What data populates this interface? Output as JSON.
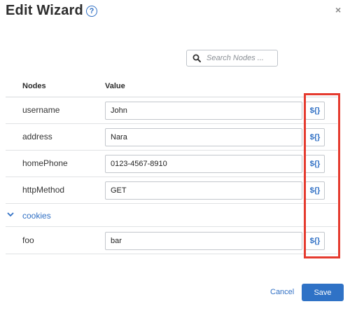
{
  "dialog": {
    "title": "Edit Wizard",
    "help_glyph": "?",
    "close_glyph": "×"
  },
  "search": {
    "placeholder": "Search Nodes ...",
    "value": ""
  },
  "table": {
    "headers": {
      "nodes": "Nodes",
      "value": "Value"
    },
    "rows": [
      {
        "node": "username",
        "value": "John",
        "action": "${}"
      },
      {
        "node": "address",
        "value": "Nara",
        "action": "${}"
      },
      {
        "node": "homePhone",
        "value": "0123-4567-8910",
        "action": "${}"
      },
      {
        "node": "httpMethod",
        "value": "GET",
        "action": "${}"
      }
    ],
    "group": {
      "label": "cookies",
      "expanded": true
    },
    "group_rows": [
      {
        "node": "foo",
        "value": "bar",
        "action": "${}"
      }
    ]
  },
  "footer": {
    "cancel_label": "Cancel",
    "save_label": "Save"
  },
  "colors": {
    "accent": "#2f72c6",
    "link": "#2f6fc4",
    "highlight": "#e53b2f"
  }
}
